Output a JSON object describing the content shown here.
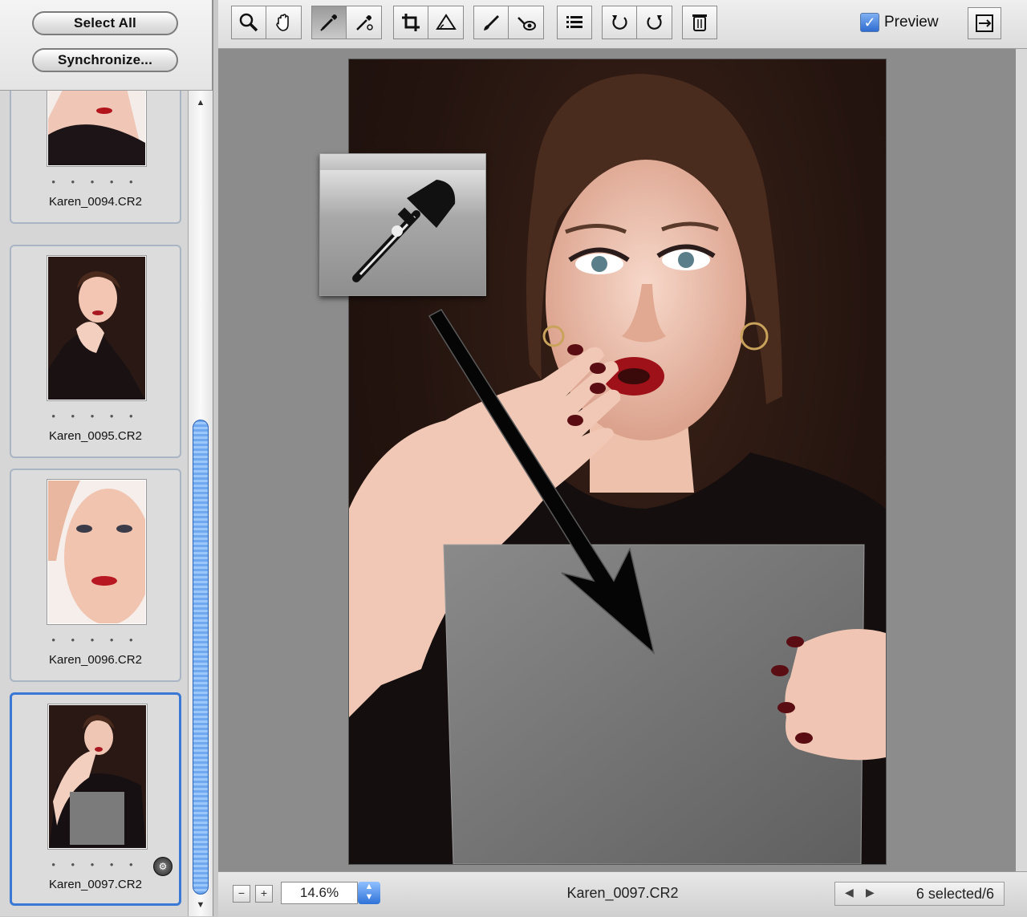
{
  "sidebar": {
    "select_all_label": "Select All",
    "synchronize_label": "Synchronize...",
    "thumbnails": [
      {
        "filename": "Karen_0094.CR2",
        "rating": "• • • • •",
        "selected": false
      },
      {
        "filename": "Karen_0095.CR2",
        "rating": "• • • • •",
        "selected": false
      },
      {
        "filename": "Karen_0096.CR2",
        "rating": "• • • • •",
        "selected": false
      },
      {
        "filename": "Karen_0097.CR2",
        "rating": "• • • • •",
        "selected": true
      }
    ]
  },
  "toolbar": {
    "tools": [
      "zoom-tool",
      "hand-tool",
      "white-balance-tool",
      "color-sampler-tool",
      "crop-tool",
      "straighten-tool",
      "retouch-tool",
      "red-eye-tool",
      "preferences-tool",
      "rotate-left-tool",
      "rotate-right-tool",
      "trash-tool"
    ],
    "active_tool": "white-balance-tool",
    "preview_label": "Preview",
    "preview_checked": true
  },
  "footer": {
    "zoom_value": "14.6%",
    "filename": "Karen_0097.CR2",
    "selection_count": "6 selected/6"
  },
  "colors": {
    "selection_blue": "#3a78d6",
    "canvas_gray": "#8c8c8c",
    "photo_background": "#24140f"
  }
}
